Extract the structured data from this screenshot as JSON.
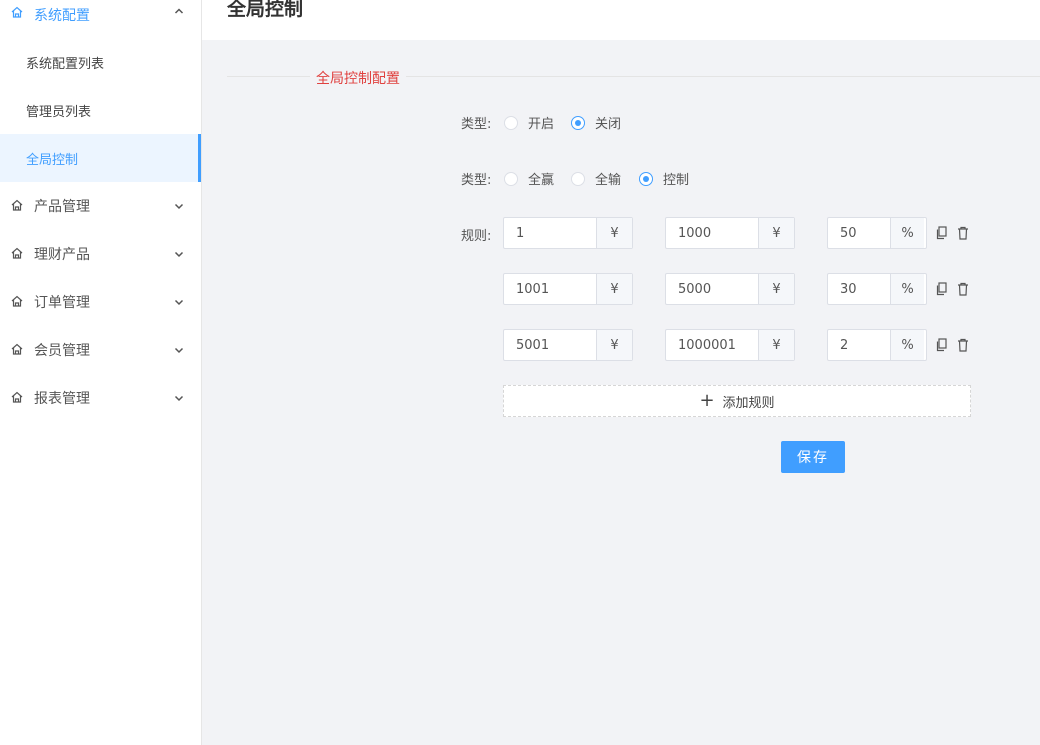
{
  "sidebar": {
    "groups": [
      {
        "label": "系统配置",
        "expanded": true,
        "items": [
          "系统配置列表",
          "管理员列表",
          "全局控制"
        ],
        "active_item": "全局控制"
      },
      {
        "label": "产品管理"
      },
      {
        "label": "理财产品"
      },
      {
        "label": "订单管理"
      },
      {
        "label": "会员管理"
      },
      {
        "label": "报表管理"
      }
    ]
  },
  "header": {
    "title": "全局控制"
  },
  "main": {
    "section_title": "全局控制配置",
    "switch": {
      "label": "类型:",
      "options": [
        "开启",
        "关闭"
      ],
      "selected": "关闭"
    },
    "mode": {
      "label": "类型:",
      "options": [
        "全赢",
        "全输",
        "控制"
      ],
      "selected": "控制"
    },
    "rules_label": "规则:",
    "rules": [
      {
        "min": "1",
        "max": "1000",
        "percent": "50"
      },
      {
        "min": "1001",
        "max": "5000",
        "percent": "30"
      },
      {
        "min": "5001",
        "max": "1000001",
        "percent": "2"
      }
    ],
    "currency_symbol": "¥",
    "percent_symbol": "%",
    "add_rule_label": "添加规则",
    "save_label": "保存"
  },
  "colors": {
    "accent": "#409EFF",
    "section_title": "#e0413f"
  }
}
